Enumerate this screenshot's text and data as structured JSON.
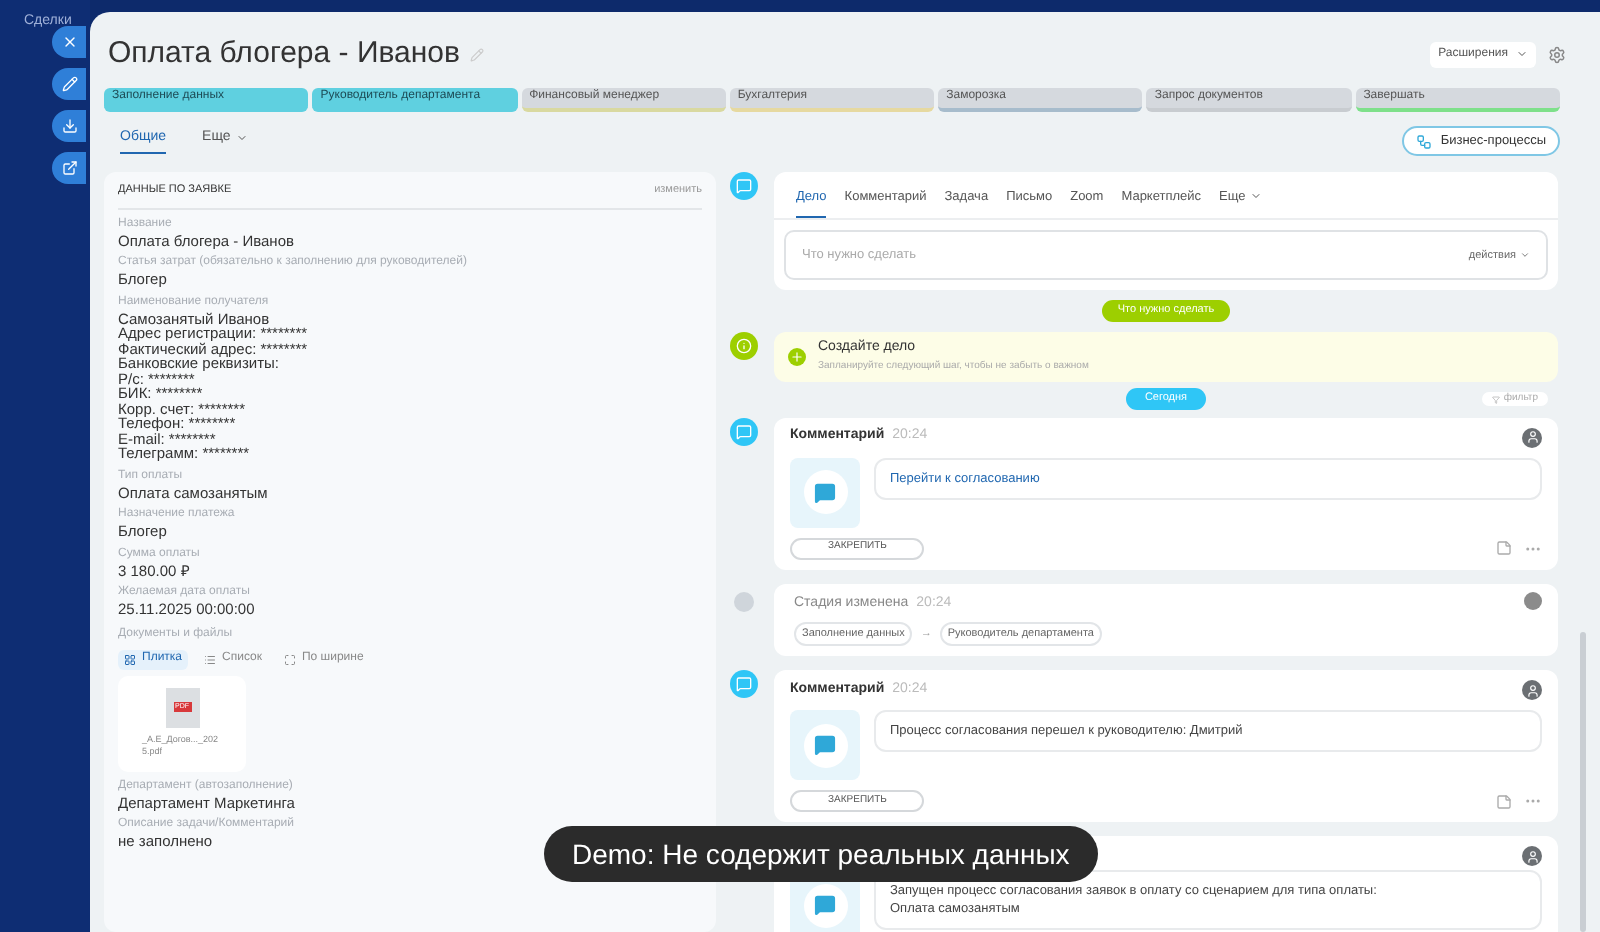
{
  "background": {
    "texts": [
      "Сделки"
    ]
  },
  "title": "Оплата блогера - Иванов",
  "extensions": "Расширения",
  "stages": [
    {
      "label": "Заполнение данных",
      "passed": true,
      "color": "#5fd0e0"
    },
    {
      "label": "Руководитель департамента",
      "passed": true,
      "color": "#5fd0e0"
    },
    {
      "label": "Финансовый менеджер",
      "passed": false,
      "color": "#d9d9a0"
    },
    {
      "label": "Бухгалтерия",
      "passed": false,
      "color": "#e6d9a0"
    },
    {
      "label": "Заморозка",
      "passed": false,
      "color": "#a7bccc"
    },
    {
      "label": "Запрос документов",
      "passed": false,
      "color": "#c8ccd0"
    },
    {
      "label": "Завершать",
      "passed": false,
      "color": "#7ee08a"
    }
  ],
  "tabs": [
    {
      "label": "Общие",
      "selected": true
    },
    {
      "label": "Еще",
      "selected": false
    }
  ],
  "business_button": "Бизнес-процессы",
  "card": {
    "title": "ДАННЫЕ ПО ЗАЯВКЕ",
    "action": "изменить",
    "fields": [
      {
        "label": "Название",
        "lines": [
          "Оплата блогера - Иванов"
        ]
      },
      {
        "label": "Статья затрат (обязательно к заполнению для руководителей)",
        "lines": [
          "Блогер"
        ]
      },
      {
        "label": "Наименование получателя",
        "lines": [
          "Самозанятый Иванов",
          "Адрес регистрации: ********",
          "Фактический адрес: ********",
          "Банковские реквизиты:",
          "Р/с: ********",
          "БИК: ********",
          "Корр. счет: ********",
          "Телефон: ********",
          "E-mail: ********",
          "Телеграмм: ********"
        ]
      },
      {
        "label": "Тип оплаты",
        "lines": [
          "Оплата самозанятым"
        ]
      },
      {
        "label": "Назначение платежа",
        "lines": [
          "Блогер"
        ]
      },
      {
        "label": "Сумма оплаты",
        "lines": [
          "3 180.00 ₽"
        ]
      },
      {
        "label": "Желаемая дата оплаты",
        "lines": [
          "25.11.2025 00:00:00"
        ]
      }
    ],
    "documents": {
      "label": "Документы и файлы",
      "views": [
        {
          "label": "Плитка",
          "selected": true
        },
        {
          "label": "Список",
          "selected": false
        },
        {
          "label": "По ширине",
          "selected": false
        }
      ],
      "file": {
        "badge": "PDF",
        "name": "_А.Е_Догов..._2025.pdf"
      }
    },
    "fields_after": [
      {
        "label": "Департамент (автозаполнение)",
        "lines": [
          "Департамент Маркетинга"
        ]
      },
      {
        "label": "Описание задачи/Комментарий",
        "lines": [
          "не заполнено"
        ]
      }
    ]
  },
  "activity": {
    "tabs": [
      {
        "label": "Дело",
        "selected": true
      },
      {
        "label": "Комментарий",
        "selected": false
      },
      {
        "label": "Задача",
        "selected": false
      },
      {
        "label": "Письмо",
        "selected": false
      },
      {
        "label": "Zoom",
        "selected": false
      },
      {
        "label": "Маркетплейс",
        "selected": false
      },
      {
        "label": "Еще",
        "selected": false
      }
    ],
    "placeholder": "Что нужно сделать",
    "actions": "действия"
  },
  "todo_pill": "Что нужно сделать",
  "create": {
    "title": "Создайте дело",
    "hint": "Запланируйте следующий шаг, чтобы не забыть о важном"
  },
  "today_pill": "Сегодня",
  "filter": "фильтр",
  "items": [
    {
      "kind": "comment",
      "title": "Комментарий",
      "time": "20:24",
      "text": [
        "Перейти к согласованию"
      ],
      "link": true,
      "pin": "ЗАКРЕПИТЬ"
    },
    {
      "kind": "stage",
      "title": "Стадия изменена",
      "time": "20:24",
      "from": "Заполнение данных",
      "arrow": "→",
      "to": "Руководитель департамента"
    },
    {
      "kind": "comment",
      "title": "Комментарий",
      "time": "20:24",
      "text": [
        "Процесс согласования перешел к руководителю: Дмитрий"
      ],
      "link": false,
      "pin": "ЗАКРЕПИТЬ"
    },
    {
      "kind": "comment",
      "text": [
        "Запущен процесс согласования заявок в оплату со сценарием для типа оплаты:",
        "Оплата самозанятым"
      ],
      "link": false
    }
  ],
  "toast": "Demo: Не содержит реальных данных"
}
